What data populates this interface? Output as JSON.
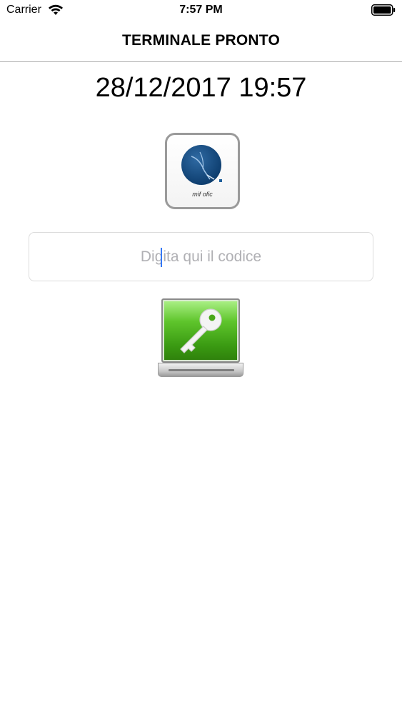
{
  "status_bar": {
    "carrier": "Carrier",
    "time": "7:57 PM",
    "wifi_icon": "wifi-icon",
    "battery_icon": "battery-full-icon"
  },
  "nav": {
    "title": "TERMINALE PRONTO"
  },
  "main": {
    "datetime": "28/12/2017 19:57",
    "logo": {
      "icon": "company-logo-icon",
      "text": "mif ofic"
    },
    "code_input": {
      "value": "",
      "placeholder": "Digita qui il codice"
    },
    "key_button": {
      "icon": "key-icon",
      "accent": "#4caf1e"
    }
  }
}
